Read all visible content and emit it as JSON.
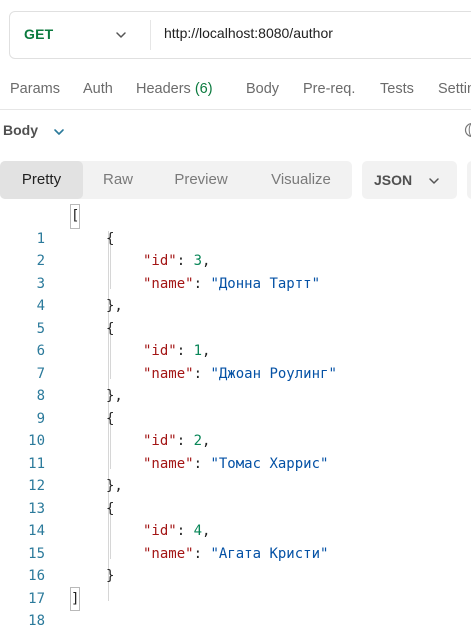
{
  "request": {
    "method": "GET",
    "url": "http://localhost:8080/author"
  },
  "icons": {
    "method_dropdown": "chevron-down-icon",
    "body_dropdown": "chevron-down-icon",
    "format_dropdown": "chevron-down-icon",
    "globe": "globe-icon"
  },
  "request_tabs": {
    "params": "Params",
    "auth": "Auth",
    "headers_label": "Headers",
    "headers_count": "(6)",
    "body": "Body",
    "prereq": "Pre-req.",
    "tests": "Tests",
    "settings": "Settings"
  },
  "response": {
    "section_label": "Body",
    "view_modes": {
      "pretty": "Pretty",
      "raw": "Raw",
      "preview": "Preview",
      "visualize": "Visualize"
    },
    "active_view": "Pretty",
    "format": "JSON"
  },
  "code": {
    "line_numbers": [
      "1",
      "2",
      "3",
      "4",
      "5",
      "6",
      "7",
      "8",
      "9",
      "10",
      "11",
      "12",
      "13",
      "14",
      "15",
      "16",
      "17",
      "18"
    ],
    "open_bracket": "[",
    "close_bracket": "]",
    "open_brace": "{",
    "close_brace_comma": "},",
    "close_brace": "}",
    "key_id": "\"id\"",
    "key_name": "\"name\"",
    "colon": ": ",
    "comma": ",",
    "records": [
      {
        "id": "3",
        "name": "\"Донна Тартт\""
      },
      {
        "id": "1",
        "name": "\"Джоан Роулинг\""
      },
      {
        "id": "2",
        "name": "\"Томас Харрис\""
      },
      {
        "id": "4",
        "name": "\"Агата Кристи\""
      }
    ]
  },
  "colors": {
    "method_get": "#0b7a3e",
    "headers_count": "#0b7a3e",
    "line_number": "#2b7a9b",
    "json_key": "#a31515",
    "json_string": "#0451a5",
    "json_number": "#098658"
  }
}
